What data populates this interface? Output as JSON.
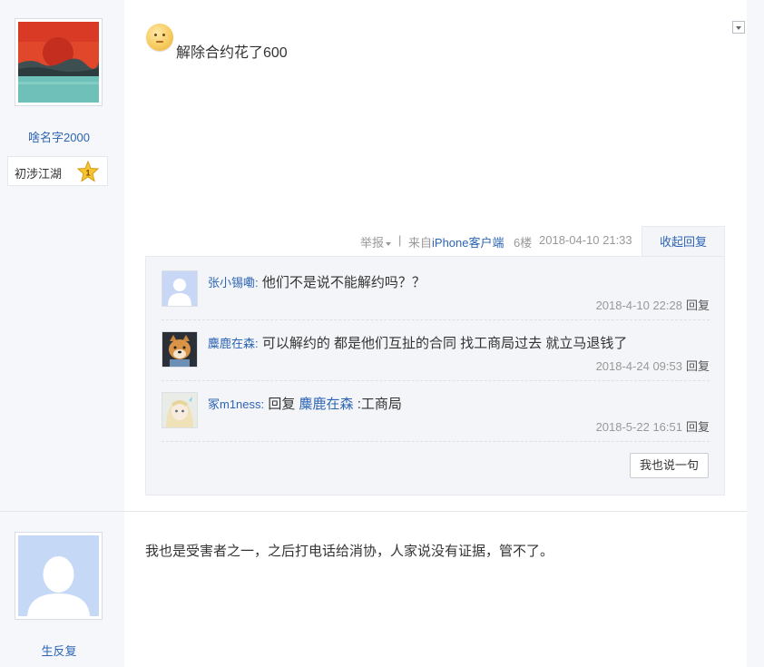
{
  "post1": {
    "author": {
      "name": "啥名字2000",
      "rank_label": "初涉江湖",
      "rank_level": "1"
    },
    "content": "解除合约花了600",
    "meta": {
      "report_label": "举报",
      "separator": "|",
      "from_prefix": "来自",
      "client": "iPhone客户端",
      "floor": "6楼",
      "time": "2018-04-10 21:33"
    },
    "collapse_label": "收起回复",
    "replies": [
      {
        "user": "张小锡嘞",
        "colon": ":",
        "text": "他们不是说不能解约吗？？",
        "time": "2018-4-10 22:28",
        "reply_label": "回复"
      },
      {
        "user": "麋鹿在森",
        "colon": ":",
        "text": "可以解约的 都是他们互扯的合同 找工商局过去 就立马退钱了",
        "time": "2018-4-24 09:53",
        "reply_label": "回复"
      },
      {
        "user": "冢m1ness",
        "colon": ":",
        "text_prefix": "回复",
        "mention": "麋鹿在森",
        "text": ":工商局",
        "time": "2018-5-22 16:51",
        "reply_label": "回复"
      }
    ],
    "say_button_label": "我也说一句"
  },
  "post2": {
    "author": {
      "name": "生反复"
    },
    "content": "我也是受害者之一，之后打电话给消协，人家说没有证据，管不了。"
  },
  "colors": {
    "link_blue": "#2d64b3",
    "meta_gray": "#999999",
    "sidebar_bg": "#f5f7fa",
    "reply_bg": "#f3f5f8"
  }
}
